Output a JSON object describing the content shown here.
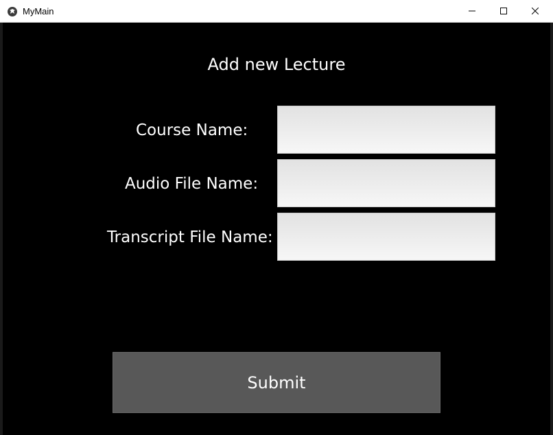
{
  "window": {
    "title": "MyMain",
    "controls": {
      "minimize_icon": "minimize-icon",
      "maximize_icon": "maximize-icon",
      "close_icon": "close-icon"
    }
  },
  "form": {
    "heading": "Add new Lecture",
    "fields": [
      {
        "label": "Course Name:",
        "value": "",
        "placeholder": ""
      },
      {
        "label": "Audio File Name:",
        "value": "",
        "placeholder": ""
      },
      {
        "label": "Transcript File Name:",
        "value": "",
        "placeholder": ""
      }
    ],
    "submit_label": "Submit"
  },
  "colors": {
    "background": "#000000",
    "titlebar": "#ffffff",
    "text": "#ffffff",
    "field_bg": "#ececec",
    "button_bg": "#585858"
  }
}
